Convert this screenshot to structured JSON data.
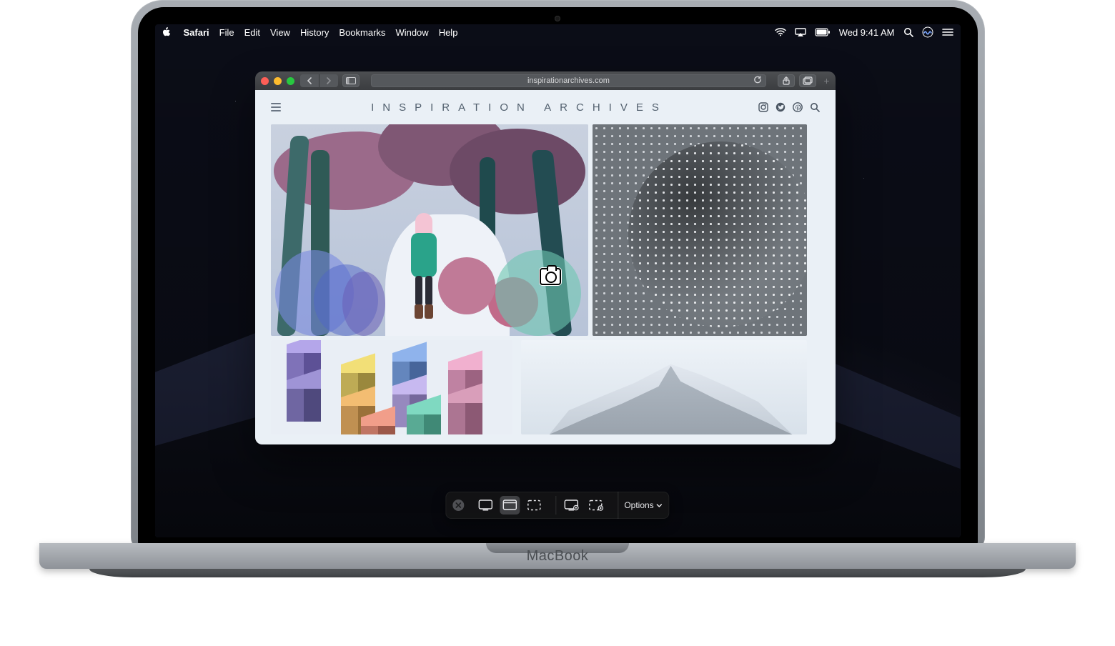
{
  "laptop": {
    "label": "MacBook"
  },
  "menubar": {
    "app": "Safari",
    "items": [
      "File",
      "Edit",
      "View",
      "History",
      "Bookmarks",
      "Window",
      "Help"
    ],
    "time": "Wed 9:41 AM"
  },
  "safari": {
    "traffic": {
      "close": "#ff5f57",
      "minimize": "#febc2e",
      "zoom": "#28c840"
    },
    "url": "inspirationarchives.com"
  },
  "site": {
    "title": "INSPIRATION ARCHIVES"
  },
  "screenshot_toolbar": {
    "options_label": "Options"
  }
}
